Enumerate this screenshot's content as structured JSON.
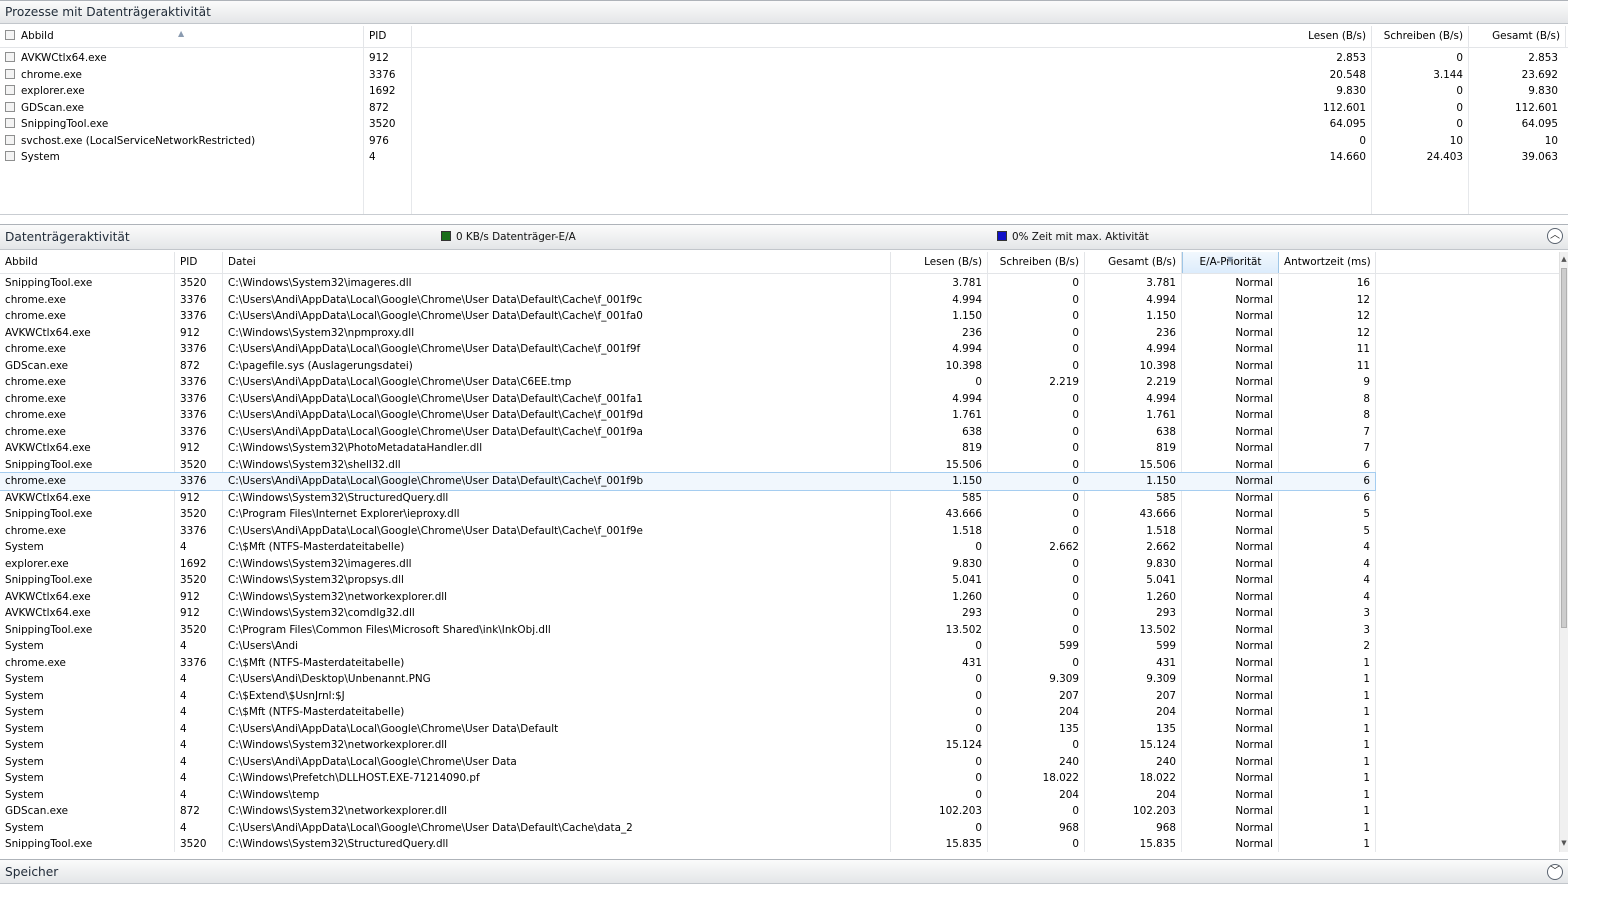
{
  "processes_section": {
    "title": "Prozesse mit Datenträgeraktivität",
    "columns": [
      "Abbild",
      "PID",
      "Lesen (B/s)",
      "Schreiben (B/s)",
      "Gesamt (B/s)"
    ],
    "rows": [
      {
        "image": "AVKWCtlx64.exe",
        "pid": "912",
        "read": "2.853",
        "write": "0",
        "total": "2.853"
      },
      {
        "image": "chrome.exe",
        "pid": "3376",
        "read": "20.548",
        "write": "3.144",
        "total": "23.692"
      },
      {
        "image": "explorer.exe",
        "pid": "1692",
        "read": "9.830",
        "write": "0",
        "total": "9.830"
      },
      {
        "image": "GDScan.exe",
        "pid": "872",
        "read": "112.601",
        "write": "0",
        "total": "112.601"
      },
      {
        "image": "SnippingTool.exe",
        "pid": "3520",
        "read": "64.095",
        "write": "0",
        "total": "64.095"
      },
      {
        "image": "svchost.exe (LocalServiceNetworkRestricted)",
        "pid": "976",
        "read": "0",
        "write": "10",
        "total": "10"
      },
      {
        "image": "System",
        "pid": "4",
        "read": "14.660",
        "write": "24.403",
        "total": "39.063"
      }
    ]
  },
  "disk_section": {
    "title": "Datenträgeraktivität",
    "legend_io": "0 KB/s Datenträger-E/A",
    "legend_time": "0% Zeit mit max. Aktivität",
    "legend_io_color": "#1a6e1a",
    "legend_time_color": "#1010c8",
    "columns": [
      "Abbild",
      "PID",
      "Datei",
      "Lesen (B/s)",
      "Schreiben (B/s)",
      "Gesamt (B/s)",
      "E/A-Priorität",
      "Antwortzeit (ms)"
    ],
    "selected_row": 12,
    "rows": [
      {
        "image": "SnippingTool.exe",
        "pid": "3520",
        "file": "C:\\Windows\\System32\\imageres.dll",
        "read": "3.781",
        "write": "0",
        "total": "3.781",
        "prio": "Normal",
        "resp": "16"
      },
      {
        "image": "chrome.exe",
        "pid": "3376",
        "file": "C:\\Users\\Andi\\AppData\\Local\\Google\\Chrome\\User Data\\Default\\Cache\\f_001f9c",
        "read": "4.994",
        "write": "0",
        "total": "4.994",
        "prio": "Normal",
        "resp": "12"
      },
      {
        "image": "chrome.exe",
        "pid": "3376",
        "file": "C:\\Users\\Andi\\AppData\\Local\\Google\\Chrome\\User Data\\Default\\Cache\\f_001fa0",
        "read": "1.150",
        "write": "0",
        "total": "1.150",
        "prio": "Normal",
        "resp": "12"
      },
      {
        "image": "AVKWCtlx64.exe",
        "pid": "912",
        "file": "C:\\Windows\\System32\\npmproxy.dll",
        "read": "236",
        "write": "0",
        "total": "236",
        "prio": "Normal",
        "resp": "12"
      },
      {
        "image": "chrome.exe",
        "pid": "3376",
        "file": "C:\\Users\\Andi\\AppData\\Local\\Google\\Chrome\\User Data\\Default\\Cache\\f_001f9f",
        "read": "4.994",
        "write": "0",
        "total": "4.994",
        "prio": "Normal",
        "resp": "11"
      },
      {
        "image": "GDScan.exe",
        "pid": "872",
        "file": "C:\\pagefile.sys (Auslagerungsdatei)",
        "read": "10.398",
        "write": "0",
        "total": "10.398",
        "prio": "Normal",
        "resp": "11"
      },
      {
        "image": "chrome.exe",
        "pid": "3376",
        "file": "C:\\Users\\Andi\\AppData\\Local\\Google\\Chrome\\User Data\\C6EE.tmp",
        "read": "0",
        "write": "2.219",
        "total": "2.219",
        "prio": "Normal",
        "resp": "9"
      },
      {
        "image": "chrome.exe",
        "pid": "3376",
        "file": "C:\\Users\\Andi\\AppData\\Local\\Google\\Chrome\\User Data\\Default\\Cache\\f_001fa1",
        "read": "4.994",
        "write": "0",
        "total": "4.994",
        "prio": "Normal",
        "resp": "8"
      },
      {
        "image": "chrome.exe",
        "pid": "3376",
        "file": "C:\\Users\\Andi\\AppData\\Local\\Google\\Chrome\\User Data\\Default\\Cache\\f_001f9d",
        "read": "1.761",
        "write": "0",
        "total": "1.761",
        "prio": "Normal",
        "resp": "8"
      },
      {
        "image": "chrome.exe",
        "pid": "3376",
        "file": "C:\\Users\\Andi\\AppData\\Local\\Google\\Chrome\\User Data\\Default\\Cache\\f_001f9a",
        "read": "638",
        "write": "0",
        "total": "638",
        "prio": "Normal",
        "resp": "7"
      },
      {
        "image": "AVKWCtlx64.exe",
        "pid": "912",
        "file": "C:\\Windows\\System32\\PhotoMetadataHandler.dll",
        "read": "819",
        "write": "0",
        "total": "819",
        "prio": "Normal",
        "resp": "7"
      },
      {
        "image": "SnippingTool.exe",
        "pid": "3520",
        "file": "C:\\Windows\\System32\\shell32.dll",
        "read": "15.506",
        "write": "0",
        "total": "15.506",
        "prio": "Normal",
        "resp": "6"
      },
      {
        "image": "chrome.exe",
        "pid": "3376",
        "file": "C:\\Users\\Andi\\AppData\\Local\\Google\\Chrome\\User Data\\Default\\Cache\\f_001f9b",
        "read": "1.150",
        "write": "0",
        "total": "1.150",
        "prio": "Normal",
        "resp": "6"
      },
      {
        "image": "AVKWCtlx64.exe",
        "pid": "912",
        "file": "C:\\Windows\\System32\\StructuredQuery.dll",
        "read": "585",
        "write": "0",
        "total": "585",
        "prio": "Normal",
        "resp": "6"
      },
      {
        "image": "SnippingTool.exe",
        "pid": "3520",
        "file": "C:\\Program Files\\Internet Explorer\\ieproxy.dll",
        "read": "43.666",
        "write": "0",
        "total": "43.666",
        "prio": "Normal",
        "resp": "5"
      },
      {
        "image": "chrome.exe",
        "pid": "3376",
        "file": "C:\\Users\\Andi\\AppData\\Local\\Google\\Chrome\\User Data\\Default\\Cache\\f_001f9e",
        "read": "1.518",
        "write": "0",
        "total": "1.518",
        "prio": "Normal",
        "resp": "5"
      },
      {
        "image": "System",
        "pid": "4",
        "file": "C:\\$Mft (NTFS-Masterdateitabelle)",
        "read": "0",
        "write": "2.662",
        "total": "2.662",
        "prio": "Normal",
        "resp": "4"
      },
      {
        "image": "explorer.exe",
        "pid": "1692",
        "file": "C:\\Windows\\System32\\imageres.dll",
        "read": "9.830",
        "write": "0",
        "total": "9.830",
        "prio": "Normal",
        "resp": "4"
      },
      {
        "image": "SnippingTool.exe",
        "pid": "3520",
        "file": "C:\\Windows\\System32\\propsys.dll",
        "read": "5.041",
        "write": "0",
        "total": "5.041",
        "prio": "Normal",
        "resp": "4"
      },
      {
        "image": "AVKWCtlx64.exe",
        "pid": "912",
        "file": "C:\\Windows\\System32\\networkexplorer.dll",
        "read": "1.260",
        "write": "0",
        "total": "1.260",
        "prio": "Normal",
        "resp": "4"
      },
      {
        "image": "AVKWCtlx64.exe",
        "pid": "912",
        "file": "C:\\Windows\\System32\\comdlg32.dll",
        "read": "293",
        "write": "0",
        "total": "293",
        "prio": "Normal",
        "resp": "3"
      },
      {
        "image": "SnippingTool.exe",
        "pid": "3520",
        "file": "C:\\Program Files\\Common Files\\Microsoft Shared\\ink\\InkObj.dll",
        "read": "13.502",
        "write": "0",
        "total": "13.502",
        "prio": "Normal",
        "resp": "3"
      },
      {
        "image": "System",
        "pid": "4",
        "file": "C:\\Users\\Andi",
        "read": "0",
        "write": "599",
        "total": "599",
        "prio": "Normal",
        "resp": "2"
      },
      {
        "image": "chrome.exe",
        "pid": "3376",
        "file": "C:\\$Mft (NTFS-Masterdateitabelle)",
        "read": "431",
        "write": "0",
        "total": "431",
        "prio": "Normal",
        "resp": "1"
      },
      {
        "image": "System",
        "pid": "4",
        "file": "C:\\Users\\Andi\\Desktop\\Unbenannt.PNG",
        "read": "0",
        "write": "9.309",
        "total": "9.309",
        "prio": "Normal",
        "resp": "1"
      },
      {
        "image": "System",
        "pid": "4",
        "file": "C:\\$Extend\\$UsnJrnl:$J",
        "read": "0",
        "write": "207",
        "total": "207",
        "prio": "Normal",
        "resp": "1"
      },
      {
        "image": "System",
        "pid": "4",
        "file": "C:\\$Mft (NTFS-Masterdateitabelle)",
        "read": "0",
        "write": "204",
        "total": "204",
        "prio": "Normal",
        "resp": "1"
      },
      {
        "image": "System",
        "pid": "4",
        "file": "C:\\Users\\Andi\\AppData\\Local\\Google\\Chrome\\User Data\\Default",
        "read": "0",
        "write": "135",
        "total": "135",
        "prio": "Normal",
        "resp": "1"
      },
      {
        "image": "System",
        "pid": "4",
        "file": "C:\\Windows\\System32\\networkexplorer.dll",
        "read": "15.124",
        "write": "0",
        "total": "15.124",
        "prio": "Normal",
        "resp": "1"
      },
      {
        "image": "System",
        "pid": "4",
        "file": "C:\\Users\\Andi\\AppData\\Local\\Google\\Chrome\\User Data",
        "read": "0",
        "write": "240",
        "total": "240",
        "prio": "Normal",
        "resp": "1"
      },
      {
        "image": "System",
        "pid": "4",
        "file": "C:\\Windows\\Prefetch\\DLLHOST.EXE-71214090.pf",
        "read": "0",
        "write": "18.022",
        "total": "18.022",
        "prio": "Normal",
        "resp": "1"
      },
      {
        "image": "System",
        "pid": "4",
        "file": "C:\\Windows\\temp",
        "read": "0",
        "write": "204",
        "total": "204",
        "prio": "Normal",
        "resp": "1"
      },
      {
        "image": "GDScan.exe",
        "pid": "872",
        "file": "C:\\Windows\\System32\\networkexplorer.dll",
        "read": "102.203",
        "write": "0",
        "total": "102.203",
        "prio": "Normal",
        "resp": "1"
      },
      {
        "image": "System",
        "pid": "4",
        "file": "C:\\Users\\Andi\\AppData\\Local\\Google\\Chrome\\User Data\\Default\\Cache\\data_2",
        "read": "0",
        "write": "968",
        "total": "968",
        "prio": "Normal",
        "resp": "1"
      },
      {
        "image": "SnippingTool.exe",
        "pid": "3520",
        "file": "C:\\Windows\\System32\\StructuredQuery.dll",
        "read": "15.835",
        "write": "0",
        "total": "15.835",
        "prio": "Normal",
        "resp": "1"
      }
    ]
  },
  "memory_section": {
    "title": "Speicher"
  }
}
